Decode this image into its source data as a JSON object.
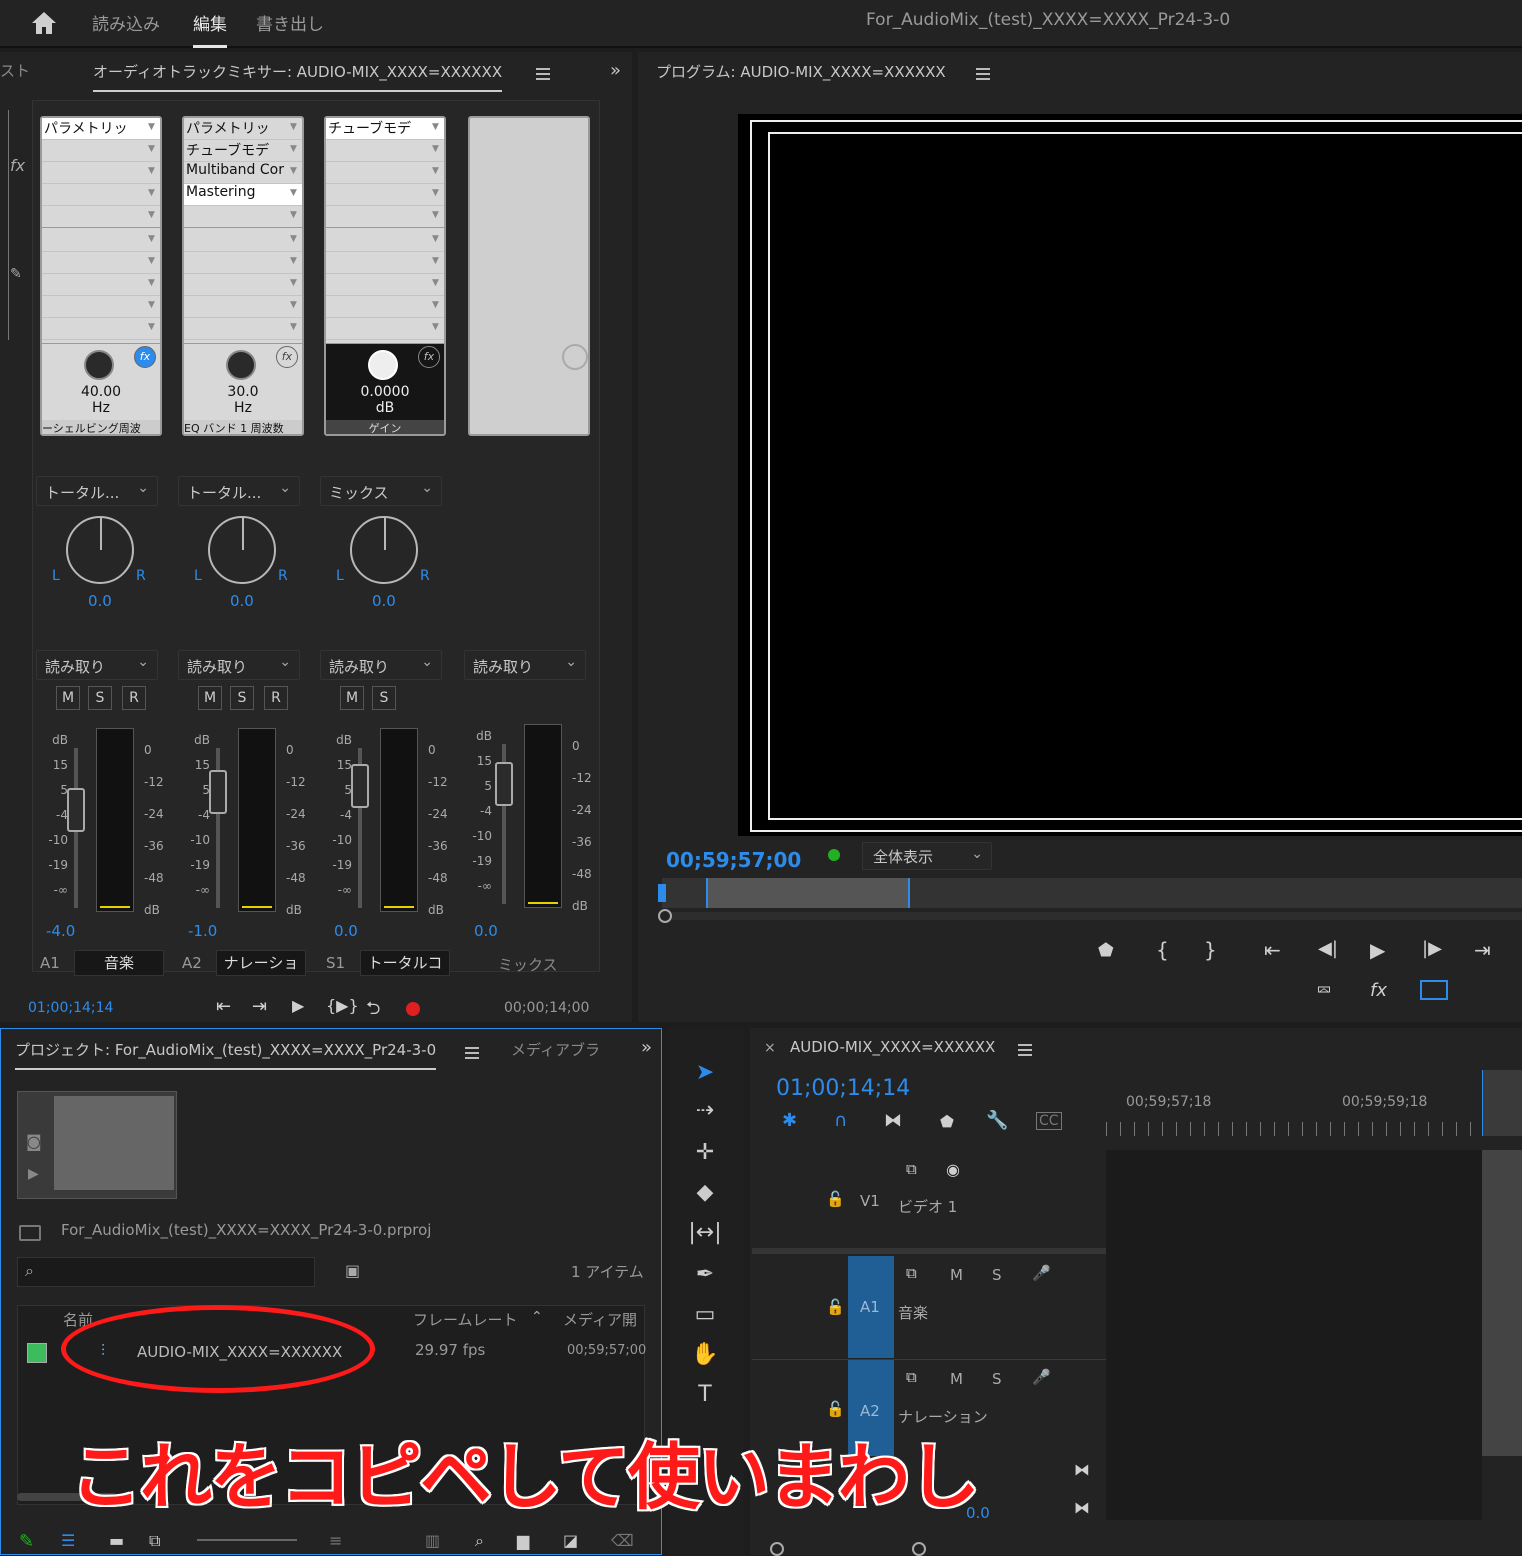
{
  "app": {
    "window_title": "For_AudioMix_(test)_XXXX=XXXX_Pr24-3-0"
  },
  "workspaces": [
    "読み込み",
    "編集",
    "書き出し"
  ],
  "mixer": {
    "left_tab": "スト",
    "tab_title": "オーディオトラックミキサー: AUDIO-MIX_XXXX=XXXXXX",
    "channels": [
      {
        "id": "A1",
        "name": "音楽",
        "fx": [
          "パラメトリッ",
          "",
          "",
          "",
          ""
        ],
        "knob_value": "40.00",
        "knob_unit": "Hz",
        "param_label": "ーシェルビング周波",
        "route": "トータル...",
        "pan_value": "0.0",
        "auto": "読み取り",
        "volume": "-4.0",
        "buttons": [
          "M",
          "S",
          "R"
        ]
      },
      {
        "id": "A2",
        "name": "ナレーショ",
        "fx": [
          "パラメトリッ",
          "チューブモデ",
          "Multiband Cor",
          "Mastering",
          ""
        ],
        "knob_value": "30.0",
        "knob_unit": "Hz",
        "param_label": "EQ バンド 1 周波数",
        "route": "トータル...",
        "pan_value": "0.0",
        "auto": "読み取り",
        "volume": "-1.0",
        "buttons": [
          "M",
          "S",
          "R"
        ]
      },
      {
        "id": "S1",
        "name": "トータルコ",
        "fx": [
          "チューブモデ",
          "",
          "",
          "",
          ""
        ],
        "knob_value": "0.0000",
        "knob_unit": "dB",
        "param_label": "ゲイン",
        "route": "ミックス",
        "pan_value": "0.0",
        "auto": "読み取り",
        "volume": "0.0",
        "buttons": [
          "M",
          "S"
        ]
      },
      {
        "id": "",
        "name": "ミックス",
        "auto": "読み取り",
        "volume": "0.0"
      }
    ],
    "pan_l": "L",
    "pan_r": "R",
    "db_label": "dB",
    "fader_scale": [
      "15",
      "5",
      "0",
      "-4",
      "-10",
      "-19",
      "-∞"
    ],
    "meter_scale": [
      "0",
      "-12",
      "-24",
      "-36",
      "-48",
      "dB"
    ],
    "time_current": "01;00;14;14",
    "time_end": "00;00;14;00"
  },
  "program": {
    "tab_title": "プログラム: AUDIO-MIX_XXXX=XXXXXX",
    "timecode": "00;59;57;00",
    "zoom": "全体表示"
  },
  "project": {
    "tab_title": "プロジェクト: For_AudioMix_(test)_XXXX=XXXX_Pr24-3-0",
    "tab2": "メディアブラ",
    "file": "For_AudioMix_(test)_XXXX=XXXX_Pr24-3-0.prproj",
    "item_count": "1 アイテム",
    "columns": [
      "名前",
      "フレームレート",
      "メディア開"
    ],
    "rows": [
      {
        "name": "AUDIO-MIX_XXXX=XXXXXX",
        "fps": "29.97 fps",
        "start": "00;59;57;00"
      }
    ]
  },
  "timeline": {
    "tab_title": "AUDIO-MIX_XXXX=XXXXXX",
    "timecode": "01;00;14;14",
    "ruler": [
      "00;59;57;18",
      "00;59;59;18"
    ],
    "tracks": [
      {
        "id": "V1",
        "name": "ビデオ 1"
      },
      {
        "id": "A1",
        "name": "音楽"
      },
      {
        "id": "A2",
        "name": "ナレーション"
      }
    ],
    "mix_value": "0.0",
    "track_buttons": [
      "M",
      "S"
    ]
  },
  "annotation": {
    "text": "これをコピペして使いまわし",
    "color": "#ff1a1a"
  },
  "colors": {
    "accent": "#2d8ceb",
    "record": "#e02020",
    "label_green": "#3cbc5c",
    "track_blue": "#1f5f95"
  }
}
